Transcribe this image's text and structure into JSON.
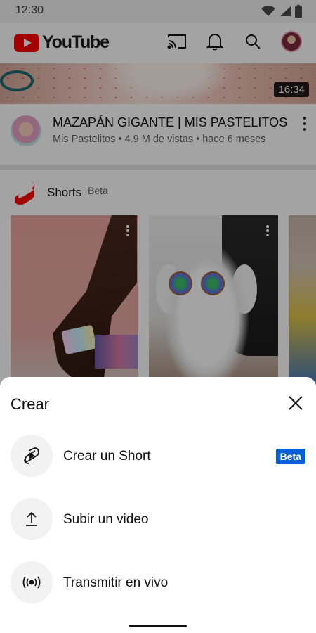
{
  "status_bar": {
    "time": "12:30",
    "icons": [
      "wifi-icon",
      "signal-icon",
      "battery-icon"
    ]
  },
  "header": {
    "logo_text": "YouTube",
    "icons": [
      "cast-icon",
      "bell-icon",
      "search-icon",
      "avatar"
    ]
  },
  "video": {
    "duration": "16:34",
    "title": "MAZAPÁN GIGANTE | MIS PASTELITOS",
    "meta": "Mis Pastelitos • 4.9 M de vistas • hace 6 meses"
  },
  "shorts": {
    "title": "Shorts",
    "badge": "Beta"
  },
  "sheet": {
    "title": "Crear",
    "options": [
      {
        "label": "Crear un Short",
        "icon": "shorts-camera-icon",
        "badge": "Beta"
      },
      {
        "label": "Subir un video",
        "icon": "upload-icon"
      },
      {
        "label": "Transmitir en vivo",
        "icon": "live-broadcast-icon"
      }
    ]
  },
  "colors": {
    "brand_red": "#ff0000",
    "beta_blue": "#065fd4",
    "scrim": "rgba(0,0,0,0.36)"
  }
}
